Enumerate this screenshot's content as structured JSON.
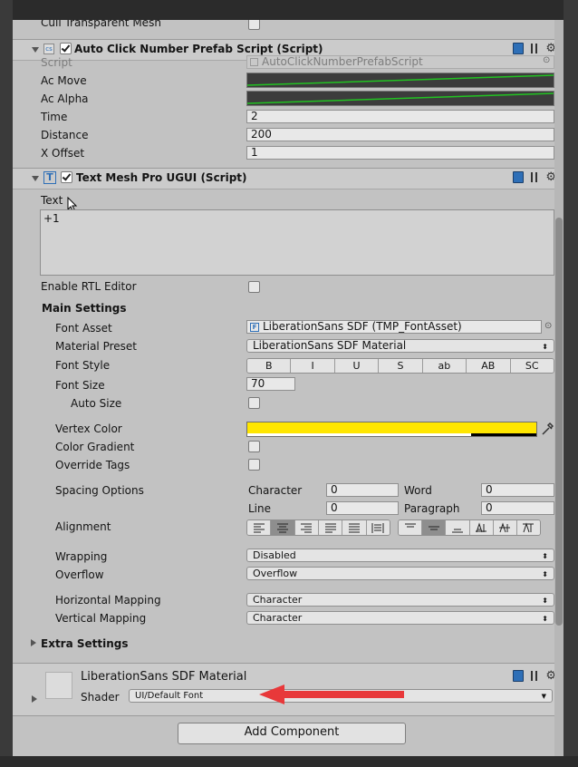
{
  "top_row": {
    "label": "Cull Transparent Mesh",
    "checked": false
  },
  "auto_click": {
    "title": "Auto Click Number Prefab Script (Script)",
    "enabled": true,
    "script_label": "Script",
    "script_value": "AutoClickNumberPrefabScript",
    "ac_move_label": "Ac Move",
    "ac_alpha_label": "Ac Alpha",
    "time_label": "Time",
    "time_value": "2",
    "distance_label": "Distance",
    "distance_value": "200",
    "xoffset_label": "X Offset",
    "xoffset_value": "1"
  },
  "tmp": {
    "title": "Text Mesh Pro UGUI (Script)",
    "enabled": true,
    "text_label": "Text",
    "text_value": "+1",
    "rtl_label": "Enable RTL Editor",
    "rtl_checked": false,
    "main_settings": "Main Settings",
    "font_asset_label": "Font Asset",
    "font_asset_value": "LiberationSans SDF (TMP_FontAsset)",
    "material_preset_label": "Material Preset",
    "material_preset_value": "LiberationSans SDF Material",
    "font_style_label": "Font Style",
    "font_style_buttons": [
      "B",
      "I",
      "U",
      "S",
      "ab",
      "AB",
      "SC"
    ],
    "font_size_label": "Font Size",
    "font_size_value": "70",
    "auto_size_label": "Auto Size",
    "auto_size_checked": false,
    "vertex_color_label": "Vertex Color",
    "vertex_color": "#ffe600",
    "color_gradient_label": "Color Gradient",
    "override_tags_label": "Override Tags",
    "spacing_label": "Spacing Options",
    "character_label": "Character",
    "character_value": "0",
    "word_label": "Word",
    "word_value": "0",
    "line_label": "Line",
    "line_value": "0",
    "paragraph_label": "Paragraph",
    "paragraph_value": "0",
    "alignment_label": "Alignment",
    "h_align_selected": 1,
    "v_align_selected": 1,
    "wrapping_label": "Wrapping",
    "wrapping_value": "Disabled",
    "overflow_label": "Overflow",
    "overflow_value": "Overflow",
    "hmap_label": "Horizontal Mapping",
    "hmap_value": "Character",
    "vmap_label": "Vertical Mapping",
    "vmap_value": "Character",
    "extra_settings": "Extra Settings"
  },
  "material": {
    "name": "LiberationSans SDF Material",
    "shader_label": "Shader",
    "shader_value": "UI/Default Font"
  },
  "add_component": "Add Component",
  "colors": {
    "annotation_arrow": "#e8383a",
    "panel": "#c2c2c2",
    "scrollbar": "#8c8c8c"
  }
}
